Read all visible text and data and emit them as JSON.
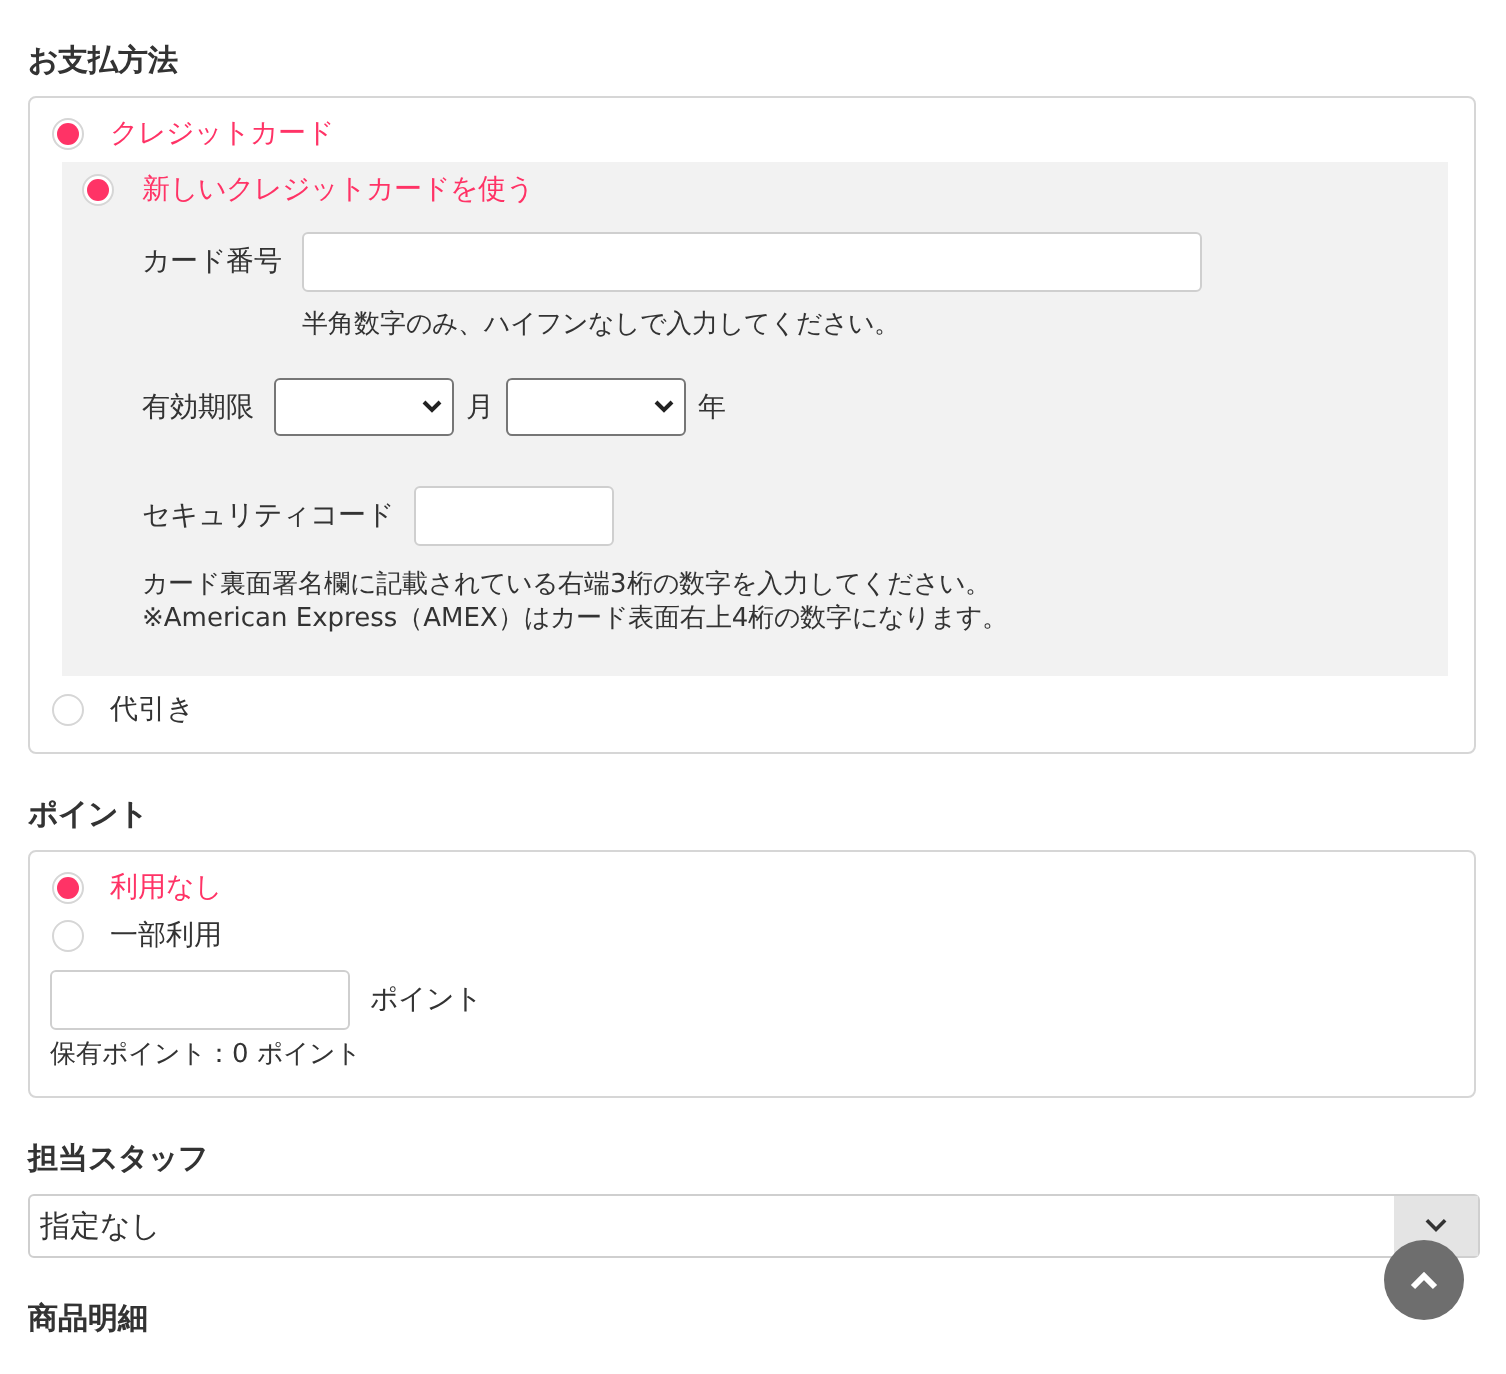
{
  "payment": {
    "heading": "お支払方法",
    "options": [
      {
        "label": "クレジットカード",
        "selected": true,
        "card_form": {
          "card_choices": [
            {
              "label": "新しいクレジットカードを使う",
              "selected": true
            }
          ],
          "card_number": {
            "label": "カード番号",
            "hint": "半角数字のみ、ハイフンなしで入力してください。"
          },
          "expiry": {
            "label": "有効期限",
            "month_unit": "月",
            "year_unit": "年"
          },
          "security_code": {
            "label": "セキュリティコード",
            "notes": [
              "カード裏面署名欄に記載されている右端3桁の数字を入力してください。",
              "※American Express（AMEX）はカード表面右上4桁の数字になります。"
            ]
          }
        }
      },
      {
        "label": "代引き",
        "selected": false
      }
    ]
  },
  "points": {
    "heading": "ポイント",
    "options": [
      {
        "label": "利用なし",
        "selected": true
      },
      {
        "label": "一部利用",
        "selected": false
      }
    ],
    "amount_field": {
      "unit": "ポイント"
    },
    "balance": "保有ポイント：0 ポイント"
  },
  "staff": {
    "heading": "担当スタッフ",
    "value": "指定なし"
  },
  "order_items": {
    "heading": "商品明細"
  }
}
